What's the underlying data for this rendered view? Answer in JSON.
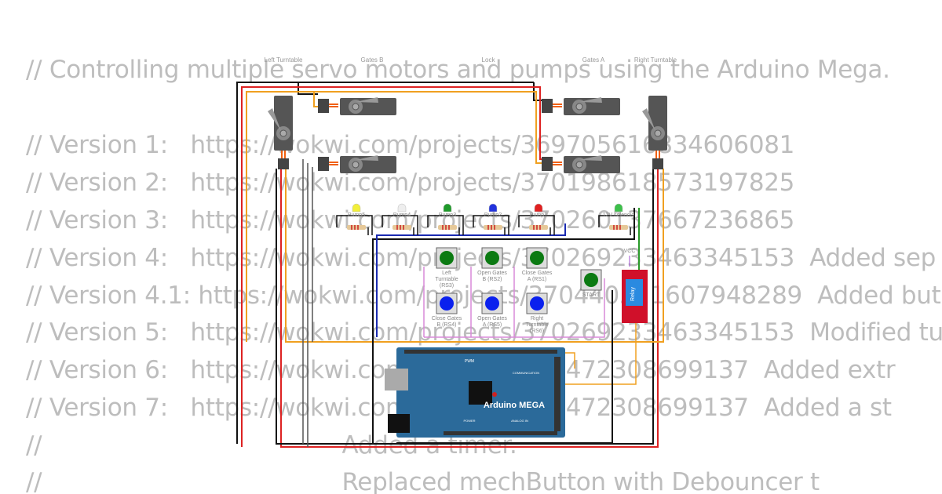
{
  "code_lines": [
    "// Controlling multiple servo motors and pumps using the Arduino Mega.",
    "",
    "// Version 1:   https://wokwi.com/projects/369705616834606081",
    "// Version 2:   https://wokwi.com/projects/370198618573197825",
    "// Version 3:   https://wokwi.com/projects/370260137667236865",
    "// Version 4:   https://wokwi.com/projects/370269233463345153  Added sep",
    "// Version 4.1: https://wokwi.com/projects/370440511607948289  Added but",
    "// Version 5:   https://wokwi.com/projects/370269233463345153  Modified tu",
    "// Version 6:   https://wokwi.com/projects/320472308699137  Added extr",
    "// Version 7:   https://wokwi.com/projects/320472308699137  Added a st",
    "//                                        Added a timer.",
    "//                                        Replaced mechButton with Debouncer t"
  ],
  "servos": {
    "left_turntable": "Left Turntable",
    "gates_b": "Gates B",
    "lock": "Lock",
    "gates_a": "Gates A",
    "right_turntable": "Right Turntable"
  },
  "leds": [
    {
      "label": "Pump5",
      "color": "#f2ef3a"
    },
    {
      "label": "Pump4",
      "color": "#eeeeee"
    },
    {
      "label": "Pump3",
      "color": "#1f9a2a"
    },
    {
      "label": "Pump2",
      "color": "#2233dd"
    },
    {
      "label": "Pump1",
      "color": "#e02020"
    },
    {
      "label": "12V solenoid",
      "color": "#3cc04a"
    }
  ],
  "buttons": [
    {
      "label": "Left Turntable (RS3)",
      "color": "#0b7a12"
    },
    {
      "label": "Open Gates B (RS2)",
      "color": "#0b7a12"
    },
    {
      "label": "Close Gates A (RS1)",
      "color": "#0b7a12"
    },
    {
      "label": "Close Gates B (RS4)",
      "color": "#0a20ee"
    },
    {
      "label": "Open Gates A (RS5)",
      "color": "#0a20ee"
    },
    {
      "label": "Right Turntable (RS6)",
      "color": "#0a20ee"
    },
    {
      "label": "START",
      "color": "#0b7a12"
    }
  ],
  "relay": {
    "label": "Relay",
    "vcc": "VCC"
  },
  "arduino": {
    "name": "Arduino MEGA",
    "pwm": "PWM",
    "communication": "COMMUNICATION",
    "power": "POWER",
    "analog_in": "ANALOG IN"
  }
}
